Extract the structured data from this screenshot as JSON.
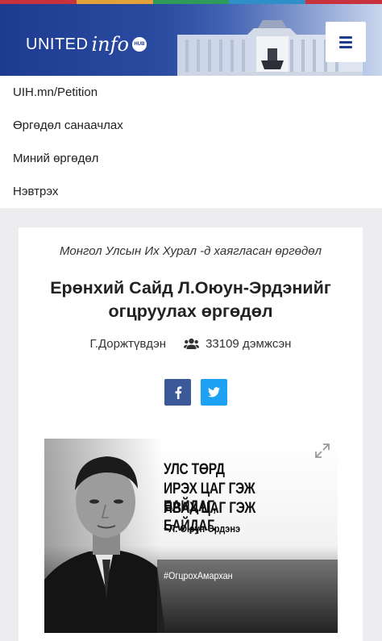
{
  "colors": {
    "brand_blue": "#1d3c91",
    "facebook": "#3b5998",
    "twitter": "#1da1f2",
    "stripe": [
      "#c8323c",
      "#e4a13a",
      "#2e9b5b",
      "#2f8fc8",
      "#c8323c"
    ]
  },
  "header": {
    "logo_united": "UNITED",
    "logo_info": "info",
    "logo_hub": "HUB",
    "menu_icon": "hamburger-icon"
  },
  "nav": {
    "items": [
      {
        "label": "UIH.mn/Petition"
      },
      {
        "label": "Өргөдөл санаачлах"
      },
      {
        "label": "Миний өргөдөл"
      },
      {
        "label": "Нэвтрэх"
      }
    ]
  },
  "petition": {
    "addressed_to": "Монгол Улсын Их Хурал -д хаягласан өргөдөл",
    "title_line1": "Ерөнхий Сайд Л.Оюун-Эрдэнийг",
    "title_line2": "огцруулах өргөдөл",
    "author": "Г.Доржтүвдэн",
    "supporters_icon": "users-icon",
    "supporters": "33109 дэмжсэн",
    "share": {
      "facebook_icon": "facebook-icon",
      "twitter_icon": "twitter-icon"
    },
    "image": {
      "quote_line1": "УЛС ТӨРД",
      "quote_line2": "ИРЭХ ЦАГ ГЭЖ БАЙДАГ,",
      "quote_line3": "ЯВАХ ЦАГ ГЭЖ БАЙДАГ.",
      "quote_author": "~Л. Оюун-Эрдэнэ",
      "hashtag": "#ОгцрохАмархан",
      "expand_icon": "expand-icon"
    }
  }
}
